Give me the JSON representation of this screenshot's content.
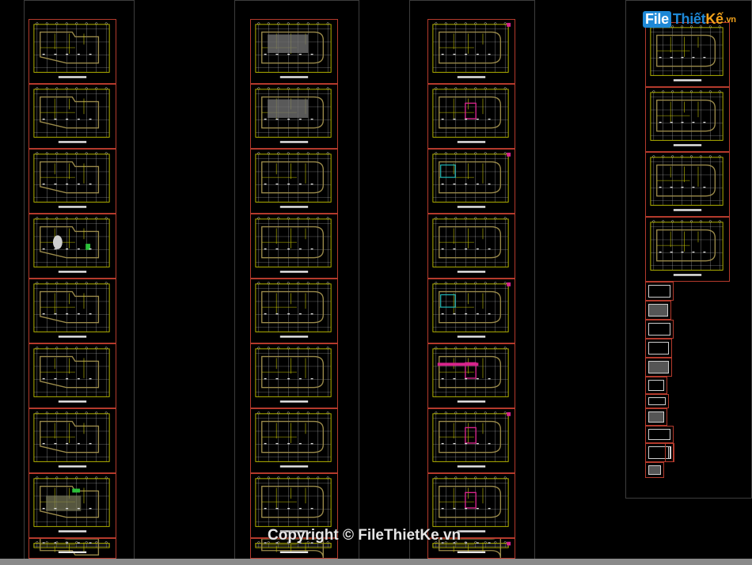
{
  "app": {
    "logo": {
      "part1": "File",
      "part2": "Thiết",
      "part3": "Kế",
      "suffix": ".vn"
    },
    "watermark": "Copyright © FileThietKe.vn"
  },
  "columns": [
    {
      "id": "col-1",
      "sheet_count": 9
    },
    {
      "id": "col-2",
      "sheet_count": 9
    },
    {
      "id": "col-3",
      "sheet_count": 9
    },
    {
      "id": "col-4",
      "sheet_count": 4,
      "detail_count": 12
    }
  ],
  "colors": {
    "background": "#000000",
    "sheet_border": "#b43a2c",
    "column_border": "#3d3d3d",
    "drawing_frame": "#c8c800",
    "grid_lines": "#d9d9d9",
    "walls": "#9a8a4a",
    "accent_magenta": "#d8248c",
    "accent_cyan": "#20b8b8",
    "accent_green": "#2bbf3a"
  }
}
